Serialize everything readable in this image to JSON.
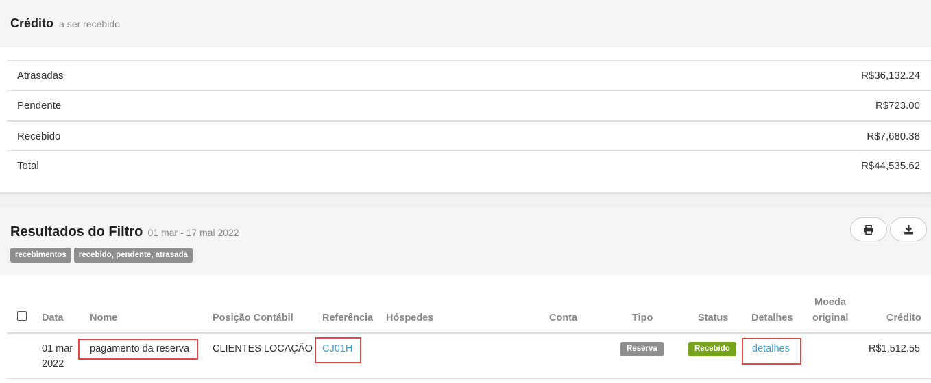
{
  "credit": {
    "title": "Crédito",
    "subtitle": "a ser recebido",
    "rows": [
      {
        "label": "Atrasadas",
        "value": "R$36,132.24"
      },
      {
        "label": "Pendente",
        "value": "R$723.00"
      },
      {
        "label": "Recebido",
        "value": "R$7,680.38"
      },
      {
        "label": "Total",
        "value": "R$44,535.62"
      }
    ]
  },
  "filter": {
    "title": "Resultados do Filtro",
    "range": "01 mar - 17 mai 2022",
    "tags": [
      "recebimentos",
      "recebido, pendente, atrasada"
    ],
    "print_icon": "print-icon",
    "download_icon": "download-icon"
  },
  "table": {
    "headers": {
      "data": "Data",
      "nome": "Nome",
      "posicao": "Posição Contábil",
      "referencia": "Referência",
      "hospedes": "Hóspedes",
      "conta": "Conta",
      "tipo": "Tipo",
      "status": "Status",
      "detalhes": "Detalhes",
      "moeda_1": "Moeda",
      "moeda_2": "original",
      "credito": "Crédito"
    },
    "rows": [
      {
        "data_1": "01 mar",
        "data_2": "2022",
        "nome": "pagamento da reserva",
        "posicao": "CLIENTES LOCAÇÃO",
        "referencia": "CJ01H",
        "hospedes": "",
        "conta": "",
        "tipo": "Reserva",
        "status": "Recebido",
        "detalhes": "detalhes",
        "moeda": "",
        "credito": "R$1,512.55"
      }
    ]
  },
  "colors": {
    "tag_gray": "#8f8f8f",
    "status_green": "#77a41a",
    "link_blue": "#3ca0d6",
    "highlight_red": "#e34747"
  }
}
